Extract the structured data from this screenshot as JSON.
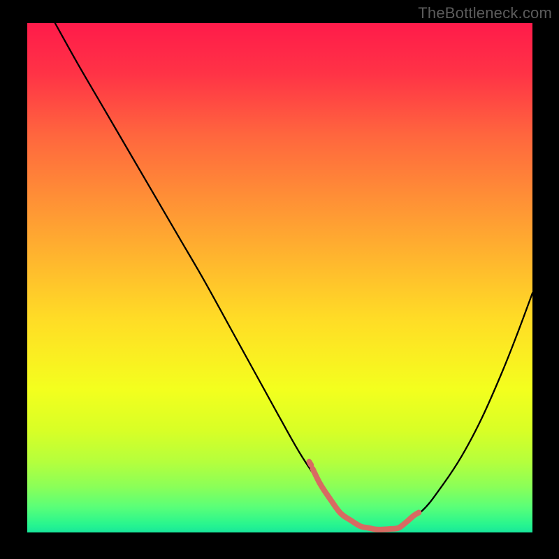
{
  "watermark": "TheBottleneck.com",
  "chart_data": {
    "type": "line",
    "title": "",
    "xlabel": "",
    "ylabel": "",
    "xlim": [
      0,
      100
    ],
    "ylim": [
      0,
      100
    ],
    "background_gradient_stops": [
      {
        "offset": 0.0,
        "color": "#ff1b4a"
      },
      {
        "offset": 0.1,
        "color": "#ff3346"
      },
      {
        "offset": 0.22,
        "color": "#ff663e"
      },
      {
        "offset": 0.34,
        "color": "#ff8e36"
      },
      {
        "offset": 0.46,
        "color": "#ffb52e"
      },
      {
        "offset": 0.58,
        "color": "#ffdc26"
      },
      {
        "offset": 0.66,
        "color": "#faf021"
      },
      {
        "offset": 0.72,
        "color": "#f3ff1e"
      },
      {
        "offset": 0.8,
        "color": "#d8ff26"
      },
      {
        "offset": 0.86,
        "color": "#b6ff3c"
      },
      {
        "offset": 0.91,
        "color": "#8bff58"
      },
      {
        "offset": 0.95,
        "color": "#5aff78"
      },
      {
        "offset": 0.985,
        "color": "#27f58f"
      },
      {
        "offset": 1.0,
        "color": "#18e69a"
      }
    ],
    "series": [
      {
        "name": "black-curve",
        "color": "#000000",
        "width": 2.3,
        "x": [
          5.5,
          10,
          15,
          20,
          25,
          30,
          35,
          40,
          45,
          50,
          54,
          58,
          61,
          64,
          67,
          70,
          73,
          78,
          82,
          86,
          90,
          94,
          97,
          100
        ],
        "y": [
          100,
          92,
          83.5,
          75,
          66.5,
          58,
          49.5,
          40.5,
          31.5,
          22.5,
          15.5,
          9.5,
          5.3,
          2.4,
          1.0,
          0.5,
          0.9,
          4.1,
          9.0,
          15.0,
          22.5,
          31.5,
          39.0,
          47.0
        ]
      },
      {
        "name": "accent-bump",
        "color": "#d86a62",
        "width": 8,
        "x": [
          56.5,
          58.0,
          60.0,
          62.0,
          64.0,
          66.0,
          67.5,
          69.0,
          70.5,
          72.0,
          73.5,
          75.0,
          76.5,
          77.5
        ],
        "y": [
          12.5,
          9.5,
          6.5,
          3.8,
          2.4,
          1.2,
          0.9,
          0.6,
          0.6,
          0.7,
          0.9,
          2.0,
          3.3,
          3.9
        ]
      },
      {
        "name": "accent-dot",
        "color": "#d86a62",
        "width": 8,
        "x": [
          55.8,
          56.2
        ],
        "y": [
          13.9,
          13.2
        ]
      }
    ]
  }
}
